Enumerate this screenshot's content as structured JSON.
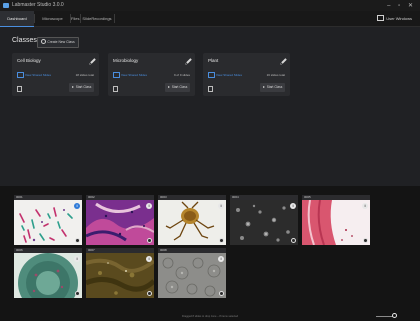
{
  "app": {
    "title": "Labmaster Studio 3.0.0",
    "controls": "– ▫ ✕"
  },
  "nav": {
    "tabs": [
      {
        "label": "Dashboard",
        "active": true
      },
      {
        "label": "Microscope",
        "active": false
      },
      {
        "label": "Files",
        "active": false
      },
      {
        "label": "SlideRecordings",
        "active": false
      }
    ],
    "user_label": "User Windows"
  },
  "classes": {
    "title": "Classes",
    "create_label": "Create New Class",
    "cards": [
      {
        "name": "Cell Biology",
        "link": "View Shared Slides",
        "meta": "18 slides total",
        "start_label": "Start Class"
      },
      {
        "name": "Microbiology",
        "link": "View Shared Slides",
        "meta": "9 of 9 slides",
        "start_label": "Start Class"
      },
      {
        "name": "Plant",
        "link": "View Shared Slides",
        "meta": "16 slides total",
        "start_label": "Start Class"
      }
    ]
  },
  "gallery": {
    "slides": [
      {
        "label": "0001",
        "info_style": "blue"
      },
      {
        "label": "0002",
        "info_style": "white"
      },
      {
        "label": "0003",
        "info_style": "white"
      },
      {
        "label": "0004",
        "info_style": "white"
      },
      {
        "label": "0005",
        "info_style": "white"
      },
      {
        "label": "0006",
        "info_style": "white"
      },
      {
        "label": "0007",
        "info_style": "white"
      },
      {
        "label": "0008",
        "info_style": "white"
      }
    ],
    "info_glyph": "i"
  },
  "footer": {
    "status": "Dragged 8 slides to drop zone – 8 items selected"
  },
  "colors": {
    "accent": "#4a8fe0",
    "background": "#202124",
    "gallery_bg": "#141414"
  }
}
